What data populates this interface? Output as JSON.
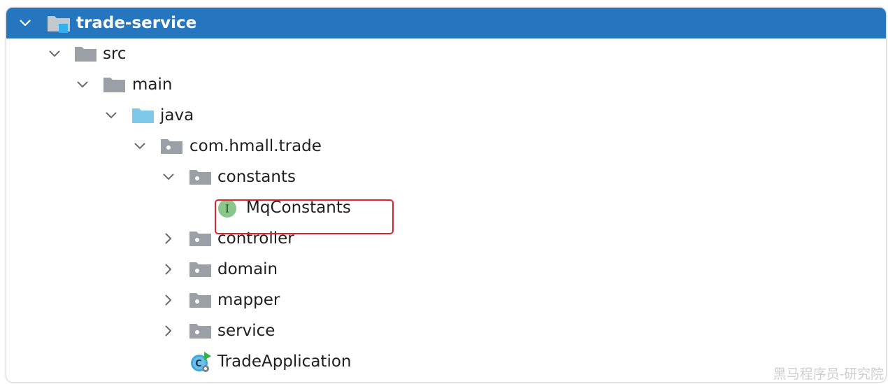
{
  "theme": {
    "selection_color": "#2675bf",
    "highlight_color": "#d8262b",
    "folder_gray": "#9aa0a6",
    "source_folder_blue": "#7ec8ea",
    "interface_badge_green": "#8bc78b"
  },
  "tree": {
    "root": {
      "label": "trade-service",
      "icon": "module-folder-icon",
      "expanded": true
    },
    "src": {
      "label": "src",
      "icon": "folder-icon",
      "expanded": true
    },
    "main": {
      "label": "main",
      "icon": "folder-icon",
      "expanded": true
    },
    "java": {
      "label": "java",
      "icon": "source-root-folder-icon",
      "expanded": true
    },
    "package": {
      "label": "com.hmall.trade",
      "icon": "package-icon",
      "expanded": true
    },
    "constants": {
      "label": "constants",
      "icon": "package-icon",
      "expanded": true
    },
    "mqconstants": {
      "label": "MqConstants",
      "icon": "interface-icon",
      "badge": "I"
    },
    "controller": {
      "label": "controller",
      "icon": "package-icon",
      "expanded": false
    },
    "domain": {
      "label": "domain",
      "icon": "package-icon",
      "expanded": false
    },
    "mapper": {
      "label": "mapper",
      "icon": "package-icon",
      "expanded": false
    },
    "service": {
      "label": "service",
      "icon": "package-icon",
      "expanded": false
    },
    "tradeapp": {
      "label": "TradeApplication",
      "icon": "spring-boot-class-icon"
    }
  },
  "watermark": "黑马程序员-研究院"
}
